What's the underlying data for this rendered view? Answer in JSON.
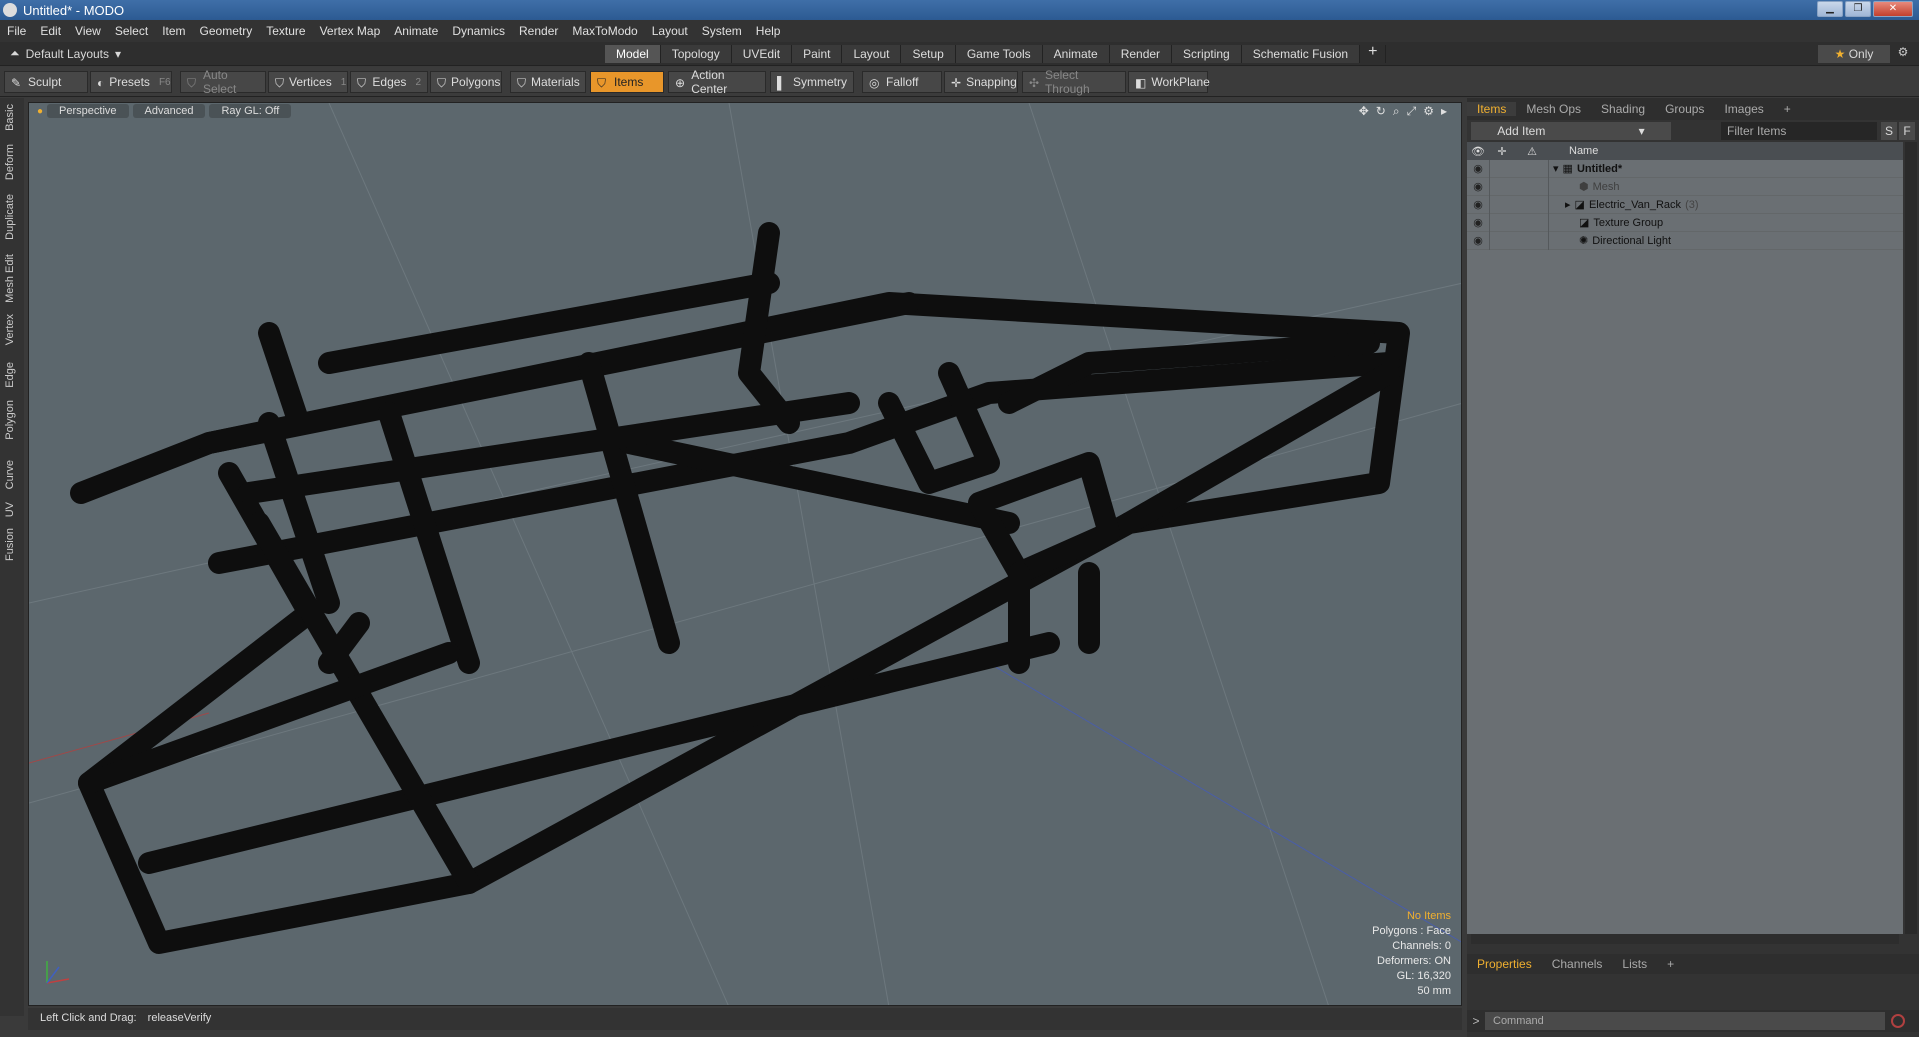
{
  "window": {
    "title": "Untitled* - MODO"
  },
  "menu": [
    "File",
    "Edit",
    "View",
    "Select",
    "Item",
    "Geometry",
    "Texture",
    "Vertex Map",
    "Animate",
    "Dynamics",
    "Render",
    "MaxToModo",
    "Layout",
    "System",
    "Help"
  ],
  "layoutbar": {
    "layouts_label": "Default Layouts",
    "tabs": [
      "Model",
      "Topology",
      "UVEdit",
      "Paint",
      "Layout",
      "Setup",
      "Game Tools",
      "Animate",
      "Render",
      "Scripting",
      "Schematic Fusion"
    ],
    "active_tab": "Model",
    "only_label": "Only"
  },
  "toolbar": {
    "sculpt": "Sculpt",
    "presets": "Presets",
    "presets_key": "F6",
    "auto_select": "Auto Select",
    "vertices": "Vertices",
    "vertices_key": "1",
    "edges": "Edges",
    "edges_key": "2",
    "polygons": "Polygons",
    "materials": "Materials",
    "items": "Items",
    "action_center": "Action Center",
    "symmetry": "Symmetry",
    "falloff": "Falloff",
    "snapping": "Snapping",
    "select_through": "Select Through",
    "workplane": "WorkPlane"
  },
  "left_tabs": [
    "Basic",
    "Deform",
    "Duplicate",
    "Mesh Edit",
    "Vertex",
    "Edge",
    "Polygon",
    "Curve",
    "UV",
    "Fusion"
  ],
  "viewport": {
    "view": "Perspective",
    "mode": "Advanced",
    "raygl": "Ray GL: Off",
    "info": {
      "selection": "No Items",
      "polygons": "Polygons : Face",
      "channels": "Channels: 0",
      "deformers": "Deformers: ON",
      "gl": "GL: 16,320",
      "scale": "50 mm"
    }
  },
  "status": {
    "hint": "Left Click and Drag:",
    "action": "releaseVerify"
  },
  "panel": {
    "tabs": [
      "Items",
      "Mesh Ops",
      "Shading",
      "Groups",
      "Images"
    ],
    "active_tab": "Items",
    "add_item": "Add Item",
    "filter_placeholder": "Filter Items",
    "s_btn": "S",
    "f_btn": "F",
    "name_header": "Name",
    "tree": [
      {
        "label": "Untitled*",
        "suffix": ""
      },
      {
        "label": "Mesh",
        "suffix": ""
      },
      {
        "label": "Electric_Van_Rack",
        "suffix": "(3)"
      },
      {
        "label": "Texture Group",
        "suffix": ""
      },
      {
        "label": "Directional Light",
        "suffix": ""
      }
    ]
  },
  "panel2": {
    "tabs": [
      "Properties",
      "Channels",
      "Lists"
    ],
    "active_tab": "Properties",
    "command_placeholder": "Command"
  },
  "colors": {
    "accent": "#f0b030",
    "viewport_bg": "#5c676d",
    "frame": "#111111"
  }
}
